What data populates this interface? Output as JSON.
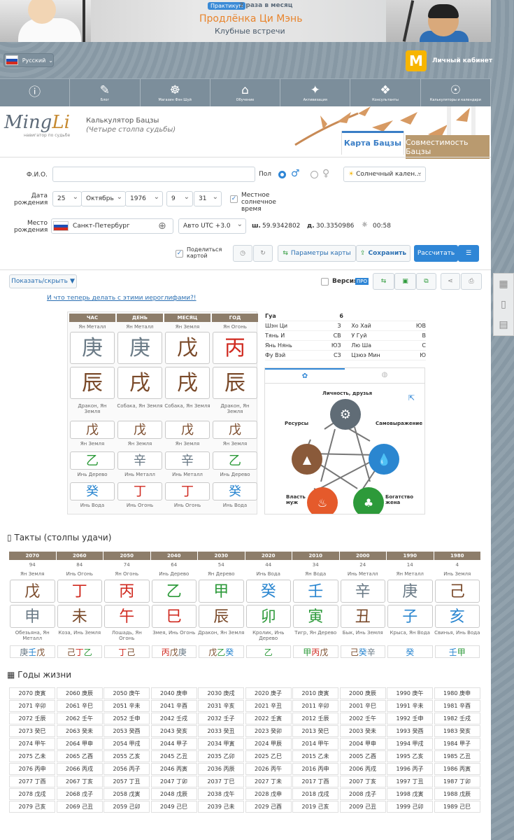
{
  "banner": {
    "badge": "Практикум",
    "freq": "2 раза в месяц",
    "title": "Продлёнка Ци Мэнь",
    "subtitle": "Клубные встречи"
  },
  "lang": "Русский",
  "cabinet": {
    "letter": "M",
    "label": "Личный кабинет"
  },
  "nav": [
    {
      "icon": "ⓘ",
      "label": ""
    },
    {
      "icon": "✎",
      "label": "Блог"
    },
    {
      "icon": "☸",
      "label": "Магазин Фэн Шуй"
    },
    {
      "icon": "⌂",
      "label": "Обучение"
    },
    {
      "icon": "✦",
      "label": "Активизация"
    },
    {
      "icon": "❖",
      "label": "Консультанты"
    },
    {
      "icon": "☉",
      "label": "Калькуляторы и календари"
    }
  ],
  "logo": {
    "ming": "Ming",
    "li": "Li",
    "sub": "навигатор по судьбе"
  },
  "calc": {
    "title": "Калькулятор Бацзы",
    "subtitle": "(Четыре столпа судьбы)"
  },
  "tabs": {
    "active": "Карта Бацзы",
    "other": "Совместимость Бацзы"
  },
  "form": {
    "fio_label": "Ф.И.О.",
    "sex_label": "Пол",
    "calendar": "Солнечный кален...",
    "birth_label": "Дата рождения",
    "day": "25",
    "month": "Октябрь",
    "year": "1976",
    "hour": "9",
    "minute": "31",
    "solar_label": "Местное солнечное время",
    "place_label": "Место рождения",
    "city": "Санкт-Петербург",
    "tz": "Авто UTC +3.0",
    "lat_label": "ш.",
    "lat": "59.9342802",
    "lon_label": "д.",
    "lon": "30.3350986",
    "time": "00:58",
    "share": "Поделиться картой",
    "params": "Параметры карты",
    "save": "Сохранить",
    "calc": "Рассчитать"
  },
  "toolbar": {
    "toggle": "Показать/скрыть",
    "version": "Версия",
    "pro": "ПРО"
  },
  "link": "И что теперь делать с этими иероглифами?!",
  "pillars": [
    {
      "head": "ЧАС",
      "top": "Ян Металл",
      "stem": "庚",
      "sc": "c-metal",
      "branch": "辰",
      "bc": "c-earth",
      "animal": "Дракон, Ян Земля",
      "h": [
        [
          "戊",
          "c-earth",
          "Ян Земля"
        ],
        [
          "乙",
          "c-wood",
          "Инь Дерево"
        ],
        [
          "癸",
          "c-water",
          "Инь Вода"
        ]
      ]
    },
    {
      "head": "ДЕНЬ",
      "top": "Ян Металл",
      "stem": "庚",
      "sc": "c-metal",
      "branch": "戌",
      "bc": "c-earth",
      "animal": "Собака, Ян Земля",
      "h": [
        [
          "戊",
          "c-earth",
          "Ян Земля"
        ],
        [
          "辛",
          "c-metal",
          "Инь Металл"
        ],
        [
          "丁",
          "c-fire",
          "Инь Огонь"
        ]
      ]
    },
    {
      "head": "МЕСЯЦ",
      "top": "Ян Земля",
      "stem": "戊",
      "sc": "c-earth",
      "branch": "戌",
      "bc": "c-earth",
      "animal": "Собака, Ян Земля",
      "h": [
        [
          "戊",
          "c-earth",
          "Ян Земля"
        ],
        [
          "辛",
          "c-metal",
          "Инь Металл"
        ],
        [
          "丁",
          "c-fire",
          "Инь Огонь"
        ]
      ]
    },
    {
      "head": "ГОД",
      "top": "Ян Огонь",
      "stem": "丙",
      "sc": "c-fire",
      "branch": "辰",
      "bc": "c-earth",
      "animal": "Дракон, Ян Земля",
      "h": [
        [
          "戊",
          "c-earth",
          "Ян Земля"
        ],
        [
          "乙",
          "c-wood",
          "Инь Дерево"
        ],
        [
          "癸",
          "c-water",
          "Инь Вода"
        ]
      ]
    }
  ],
  "gua": {
    "label": "Гуа",
    "value": "6",
    "rows": [
      [
        "Шэн Ци",
        "З",
        "Хо Хай",
        "ЮВ"
      ],
      [
        "Тянь И",
        "СВ",
        "У Гуй",
        "В"
      ],
      [
        "Янь Нянь",
        "ЮЗ",
        "Лю Ша",
        "С"
      ],
      [
        "Фу Вэй",
        "СЗ",
        "Цзюэ Мин",
        "Ю"
      ]
    ]
  },
  "wheel": {
    "top": "Личность, друзья",
    "right": "Самовыражение",
    "left": "Ресурсы",
    "bl": "Власть муж",
    "br": "Богатство жена"
  },
  "luck_title": "Такты (столпы удачи)",
  "luck": [
    {
      "y": "2070",
      "a": "94",
      "t": "Ян Земля",
      "s": "戊",
      "sc": "c-earth",
      "b": "申",
      "bc": "c-metal",
      "an": "Обезьяна, Ян Металл",
      "h": "庚壬戊"
    },
    {
      "y": "2060",
      "a": "84",
      "t": "Инь Огонь",
      "s": "丁",
      "sc": "c-fire",
      "b": "未",
      "bc": "c-earth",
      "an": "Коза, Инь Земля",
      "h": "己丁乙"
    },
    {
      "y": "2050",
      "a": "74",
      "t": "Ян Огонь",
      "s": "丙",
      "sc": "c-fire",
      "b": "午",
      "bc": "c-fire",
      "an": "Лошадь, Ян Огонь",
      "h": "丁己"
    },
    {
      "y": "2040",
      "a": "64",
      "t": "Инь Дерево",
      "s": "乙",
      "sc": "c-wood",
      "b": "巳",
      "bc": "c-fire",
      "an": "Змея, Инь Огонь",
      "h": "丙戊庚"
    },
    {
      "y": "2030",
      "a": "54",
      "t": "Ян Дерево",
      "s": "甲",
      "sc": "c-wood",
      "b": "辰",
      "bc": "c-earth",
      "an": "Дракон, Ян Земля",
      "h": "戊乙癸"
    },
    {
      "y": "2020",
      "a": "44",
      "t": "Инь Вода",
      "s": "癸",
      "sc": "c-water",
      "b": "卯",
      "bc": "c-wood",
      "an": "Кролик, Инь Дерево",
      "h": "乙"
    },
    {
      "y": "2010",
      "a": "34",
      "t": "Ян Вода",
      "s": "壬",
      "sc": "c-water",
      "b": "寅",
      "bc": "c-wood",
      "an": "Тигр, Ян Дерево",
      "h": "甲丙戊"
    },
    {
      "y": "2000",
      "a": "24",
      "t": "Инь Металл",
      "s": "辛",
      "sc": "c-metal",
      "b": "丑",
      "bc": "c-earth",
      "an": "Бык, Инь Земля",
      "h": "己癸辛"
    },
    {
      "y": "1990",
      "a": "14",
      "t": "Ян Металл",
      "s": "庚",
      "sc": "c-metal",
      "b": "子",
      "bc": "c-water",
      "an": "Крыса, Ян Вода",
      "h": "癸"
    },
    {
      "y": "1980",
      "a": "4",
      "t": "Инь Земля",
      "s": "己",
      "sc": "c-earth",
      "b": "亥",
      "bc": "c-water",
      "an": "Свинья, Инь Вода",
      "h": "壬甲"
    }
  ],
  "years_title": "Годы жизни",
  "years": [
    [
      "2070 庚寅",
      "2060 庚辰",
      "2050 庚午",
      "2040 庚申",
      "2030 庚戌",
      "2020 庚子",
      "2010 庚寅",
      "2000 庚辰",
      "1990 庚午",
      "1980 庚申"
    ],
    [
      "2071 辛卯",
      "2061 辛巳",
      "2051 辛未",
      "2041 辛酉",
      "2031 辛亥",
      "2021 辛丑",
      "2011 辛卯",
      "2001 辛巳",
      "1991 辛未",
      "1981 辛酉"
    ],
    [
      "2072 壬辰",
      "2062 壬午",
      "2052 壬申",
      "2042 壬戌",
      "2032 壬子",
      "2022 壬寅",
      "2012 壬辰",
      "2002 壬午",
      "1992 壬申",
      "1982 壬戌"
    ],
    [
      "2073 癸巳",
      "2063 癸未",
      "2053 癸酉",
      "2043 癸亥",
      "2033 癸丑",
      "2023 癸卯",
      "2013 癸巳",
      "2003 癸未",
      "1993 癸酉",
      "1983 癸亥"
    ],
    [
      "2074 甲午",
      "2064 甲申",
      "2054 甲戌",
      "2044 甲子",
      "2034 甲寅",
      "2024 甲辰",
      "2014 甲午",
      "2004 甲申",
      "1994 甲戌",
      "1984 甲子"
    ],
    [
      "2075 乙未",
      "2065 乙酉",
      "2055 乙亥",
      "2045 乙丑",
      "2035 乙卯",
      "2025 乙巳",
      "2015 乙未",
      "2005 乙酉",
      "1995 乙亥",
      "1985 乙丑"
    ],
    [
      "2076 丙申",
      "2066 丙戌",
      "2056 丙子",
      "2046 丙寅",
      "2036 丙辰",
      "2026 丙午",
      "2016 丙申",
      "2006 丙戌",
      "1996 丙子",
      "1986 丙寅"
    ],
    [
      "2077 丁酉",
      "2067 丁亥",
      "2057 丁丑",
      "2047 丁卯",
      "2037 丁巳",
      "2027 丁未",
      "2017 丁酉",
      "2007 丁亥",
      "1997 丁丑",
      "1987 丁卯"
    ],
    [
      "2078 戊戌",
      "2068 戊子",
      "2058 戊寅",
      "2048 戊辰",
      "2038 戊午",
      "2028 戊申",
      "2018 戊戌",
      "2008 戊子",
      "1998 戊寅",
      "1988 戊辰"
    ],
    [
      "2079 己亥",
      "2069 己丑",
      "2059 己卯",
      "2049 己巳",
      "2039 己未",
      "2029 己酉",
      "2019 己亥",
      "2009 己丑",
      "1999 己卯",
      "1989 己巳"
    ]
  ]
}
